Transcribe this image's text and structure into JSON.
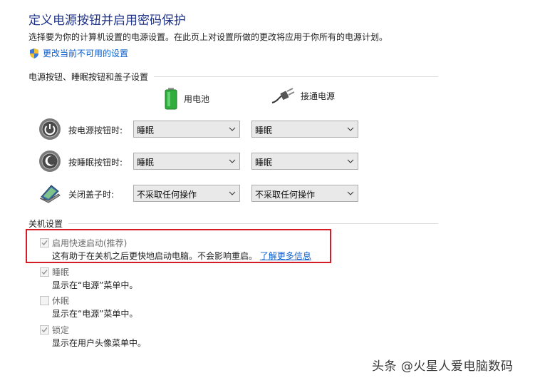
{
  "header": {
    "title": "定义电源按钮并启用密码保护",
    "subtitle": "选择要为你的计算机设置的电源设置。在此页上对设置所做的更改将应用于你所有的电源计划。",
    "admin_link": "更改当前不可用的设置"
  },
  "power_buttons_section": {
    "label": "电源按钮、睡眠按钮和盖子设置",
    "col_battery": "用电池",
    "col_plugged": "接通电源",
    "rows": [
      {
        "label": "按电源按钮时:",
        "battery": "睡眠",
        "plugged": "睡眠"
      },
      {
        "label": "按睡眠按钮时:",
        "battery": "睡眠",
        "plugged": "睡眠"
      },
      {
        "label": "关闭盖子时:",
        "battery": "不采取任何操作",
        "plugged": "不采取任何操作"
      }
    ]
  },
  "shutdown_section": {
    "label": "关机设置",
    "options": [
      {
        "title": "启用快速启动(推荐)",
        "desc": "这有助于在关机之后更快地启动电脑。不会影响重启。",
        "link": "了解更多信息",
        "checked": true
      },
      {
        "title": "睡眠",
        "desc": "显示在“电源”菜单中。",
        "checked": true
      },
      {
        "title": "休眠",
        "desc": "显示在“电源”菜单中。",
        "checked": false
      },
      {
        "title": "锁定",
        "desc": "显示在用户头像菜单中。",
        "checked": true
      }
    ]
  },
  "watermark": "头条 @火星人爱电脑数码",
  "colors": {
    "title": "#1e3287",
    "link": "#0a5ecf",
    "highlight": "#d51c26"
  }
}
